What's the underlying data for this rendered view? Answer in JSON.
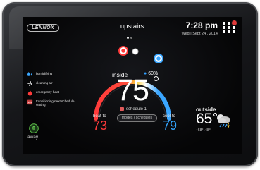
{
  "header": {
    "brand": "LENNOX",
    "zone_name": "upstairs",
    "time": "7:28 pm",
    "date": "Wed | Sept 24 , 2014",
    "menu_badge": true
  },
  "status_list": [
    {
      "label": "humidifying",
      "icon": "humidifying-icon"
    },
    {
      "label": "cleaning air",
      "icon": "fan-icon"
    },
    {
      "label": "emergency heat",
      "icon": "flame-icon"
    },
    {
      "label": "transitioning next schedule setting",
      "icon": "schedule-icon"
    }
  ],
  "indoor": {
    "label": "inside",
    "temperature": "75",
    "humidity": "60%"
  },
  "schedule": {
    "label": "schedule 1"
  },
  "modes_button": "modes / schedules",
  "heat": {
    "label": "heat-to",
    "setpoint": "73"
  },
  "cool": {
    "label": "cool-to",
    "setpoint": "79"
  },
  "outside": {
    "label": "outside",
    "temperature": "65",
    "hi_lo": "↑68°↓48°",
    "weather_icon": "partly-cloudy-rain-icon"
  },
  "away": {
    "label": "away"
  },
  "colors": {
    "heat": "#ff3a3a",
    "cool": "#33a6ff",
    "arc_warm": "#ff3b3b",
    "arc_mid": "#ffd23a",
    "arc_cool": "#3aa6ff",
    "away_green": "#5fc24a"
  }
}
